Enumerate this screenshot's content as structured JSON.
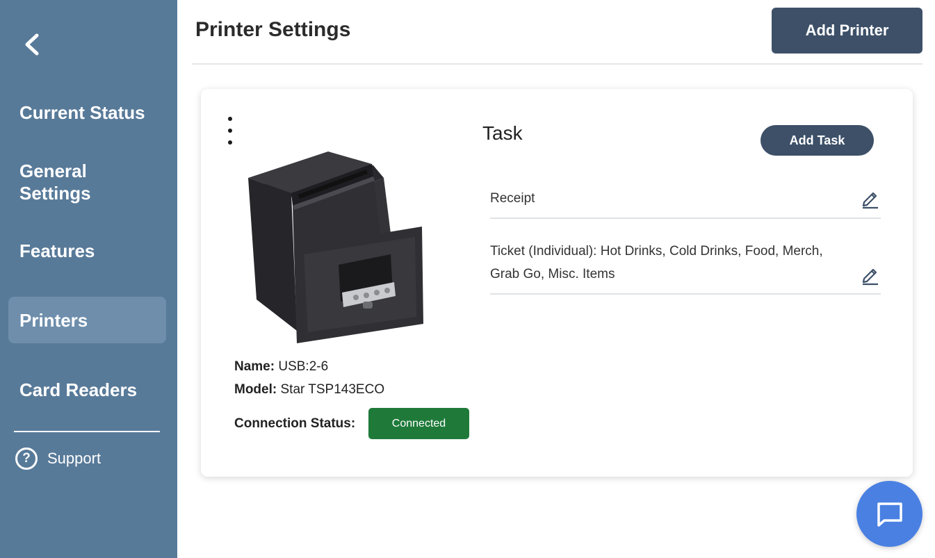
{
  "sidebar": {
    "items": [
      {
        "label": "Current Status",
        "active": false
      },
      {
        "label": "General Settings",
        "active": false
      },
      {
        "label": "Features",
        "active": false
      },
      {
        "label": "Printers",
        "active": true
      },
      {
        "label": "Card Readers",
        "active": false
      }
    ],
    "support_label": "Support",
    "support_icon": "?"
  },
  "header": {
    "title": "Printer Settings",
    "add_printer_label": "Add Printer"
  },
  "printer": {
    "name_label": "Name:",
    "name_value": "USB:2-6",
    "model_label": "Model:",
    "model_value": "Star TSP143ECO",
    "status_label": "Connection Status:",
    "status_value": "Connected"
  },
  "tasks": {
    "title": "Task",
    "add_task_label": "Add Task",
    "items": [
      {
        "text": "Receipt"
      },
      {
        "text": "Ticket (Individual): Hot Drinks, Cold Drinks, Food, Merch, Grab Go, Misc. Items"
      }
    ]
  },
  "colors": {
    "sidebar": "#587a99",
    "sidebar_active": "#6e8eac",
    "primary_button": "#3d5068",
    "status_connected": "#1f7a3a",
    "chat_button": "#4a80e2"
  }
}
